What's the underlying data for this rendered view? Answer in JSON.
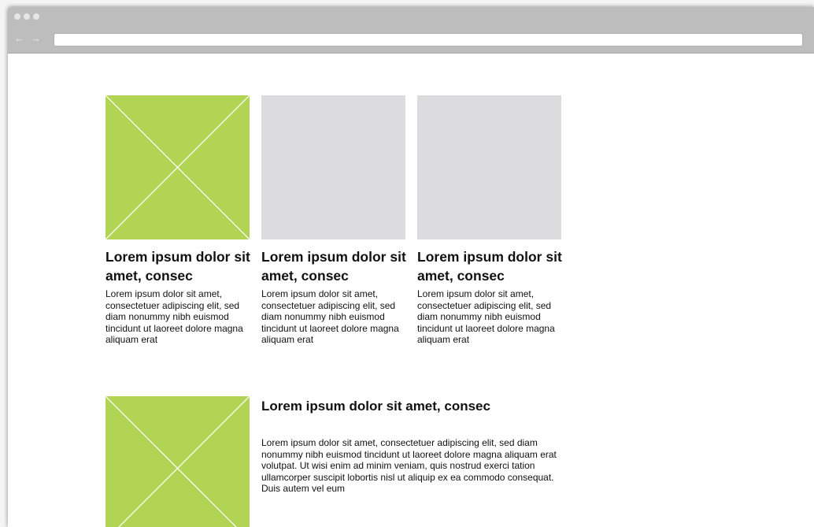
{
  "browser": {
    "back_glyph": "←",
    "forward_glyph": "→",
    "address_value": ""
  },
  "colors": {
    "placeholder_active": "#b2d455",
    "placeholder_inactive": "#dcdbdd",
    "chrome": "#bdbdbd"
  },
  "cards": [
    {
      "title": "Lorem ipsum dolor sit amet, consec",
      "body": "Lorem ipsum dolor sit amet, consectetuer adipiscing elit, sed diam nonummy nibh euismod tincidunt ut laoreet dolore magna aliquam erat",
      "image": "image-placeholder"
    },
    {
      "title": "Lorem ipsum dolor sit amet, consec",
      "body": "Lorem ipsum dolor sit amet, consectetuer adipiscing elit, sed diam nonummy nibh euismod tincidunt ut laoreet dolore magna aliquam erat",
      "image": "empty-placeholder"
    },
    {
      "title": "Lorem ipsum dolor sit amet, consec",
      "body": "Lorem ipsum dolor sit amet, consectetuer adipiscing elit, sed diam nonummy nibh euismod tincidunt ut laoreet dolore magna aliquam erat",
      "image": "empty-placeholder"
    }
  ],
  "feature": {
    "title": "Lorem ipsum dolor sit amet, consec",
    "body": "Lorem ipsum dolor sit amet, consectetuer adipiscing elit, sed diam nonummy nibh euismod tincidunt ut laoreet dolore magna aliquam erat volutpat. Ut wisi enim ad minim veniam, quis nostrud exerci tation ullamcorper suscipit lobortis nisl ut aliquip ex ea commodo consequat. Duis autem vel eum",
    "image": "image-placeholder"
  }
}
